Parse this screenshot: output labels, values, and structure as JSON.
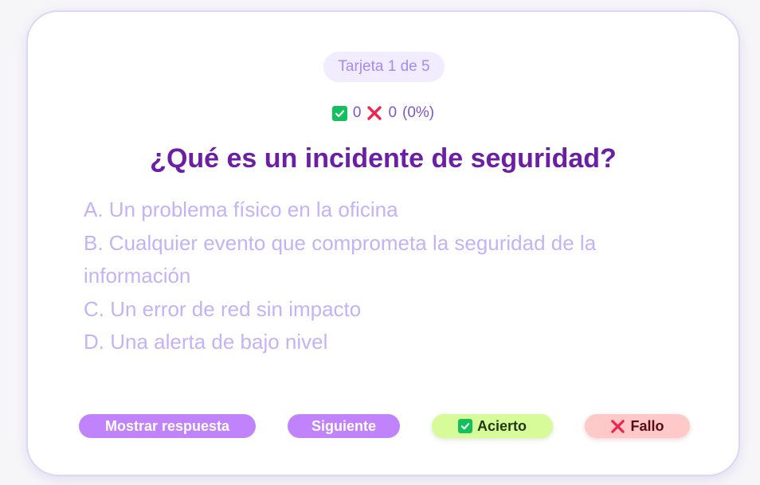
{
  "card": {
    "counter": "Tarjeta 1 de 5",
    "score": {
      "correct": "0",
      "wrong": "0",
      "percent": "(0%)"
    },
    "question": "¿Qué es un incidente de seguridad?",
    "options": [
      "A. Un problema físico en la oficina",
      "B. Cualquier evento que comprometa la seguridad de la información",
      "C. Un error de red sin impacto",
      "D. Una alerta de bajo nivel"
    ]
  },
  "actions": {
    "show_answer": "Mostrar respuesta",
    "next": "Siguiente",
    "hit": "Acierto",
    "miss": "Fallo"
  },
  "icons": {
    "check": "check-square-icon",
    "cross": "cross-icon"
  },
  "colors": {
    "accent": "#6a1fa4",
    "button_primary": "#c083fb",
    "hit_bg": "#d7fb98",
    "miss_bg": "#ffc9c9",
    "check_green": "#12c15e",
    "cross_red": "#f0254f",
    "option_text": "#c3b3f7"
  }
}
